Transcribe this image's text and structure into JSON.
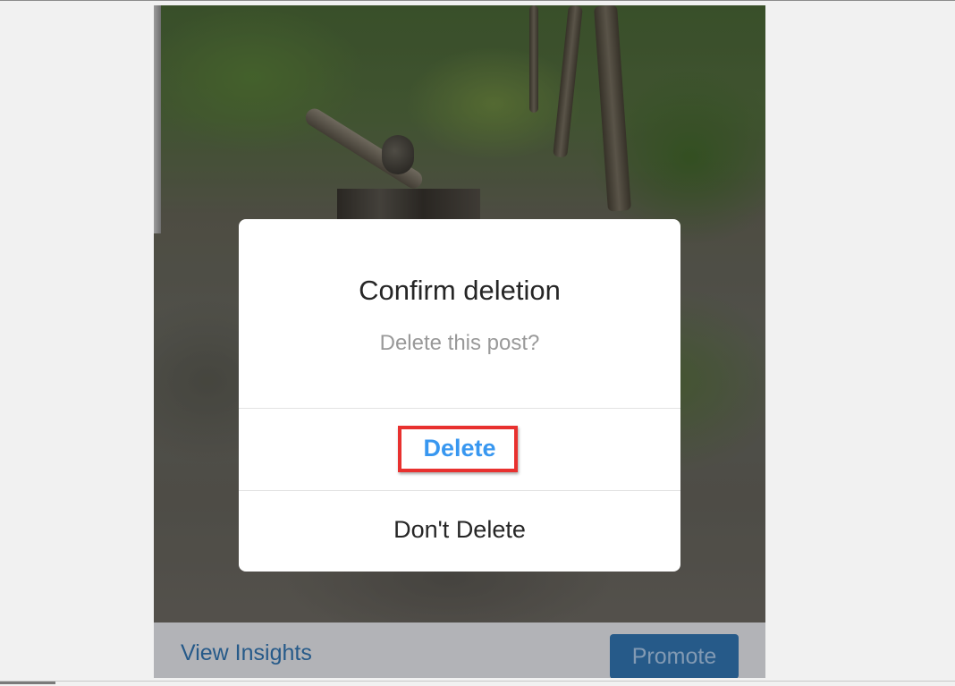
{
  "dialog": {
    "title": "Confirm deletion",
    "message": "Delete this post?",
    "confirm_label": "Delete",
    "cancel_label": "Don't Delete"
  },
  "post_actions": {
    "insights_label": "View Insights",
    "promote_label": "Promote"
  },
  "colors": {
    "confirm_text": "#3897f0",
    "highlight_border": "#e8312f",
    "promote_button": "#2f6ea8"
  }
}
